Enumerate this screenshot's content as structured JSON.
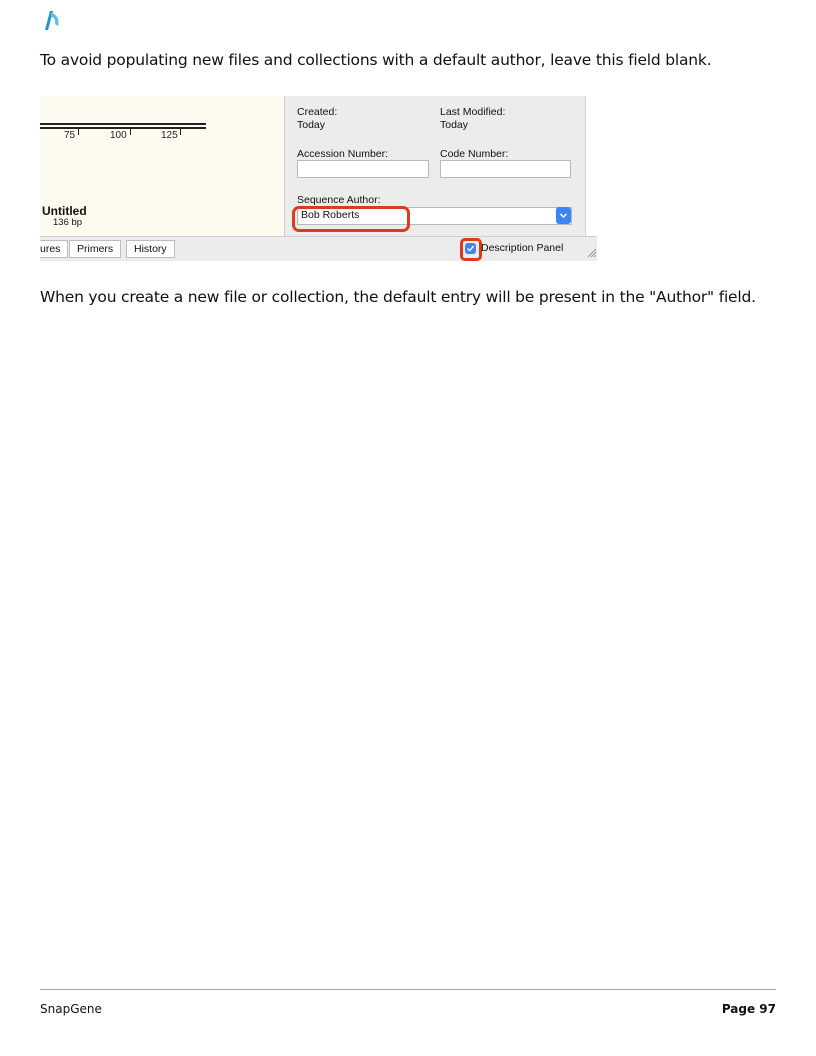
{
  "logo": {
    "icon": "snapgene-logo-icon",
    "color": "#3aa7e0"
  },
  "intro_text": "To avoid populating new files and collections with a default author, leave this field blank.",
  "screenshot": {
    "ruler_ticks": [
      "75",
      "100",
      "125"
    ],
    "sequence_name": "Untitled",
    "sequence_length": "136 bp",
    "created_label": "Created:",
    "created_value": "Today",
    "modified_label": "Last Modified:",
    "modified_value": "Today",
    "accession_label": "Accession Number:",
    "accession_value": "",
    "code_label": "Code Number:",
    "code_value": "",
    "author_label": "Sequence Author:",
    "author_value": "Bob Roberts",
    "tabs": [
      "ures",
      "Primers",
      "History"
    ],
    "description_panel_label": "Description Panel",
    "description_panel_checked": true,
    "highlight_color": "#e03a1c",
    "accent_color": "#3b86f7"
  },
  "outro_text": "When you create a new file or collection, the default entry will be present in the \"Author\" field.",
  "footer": {
    "left": "SnapGene",
    "right": "Page 97"
  }
}
